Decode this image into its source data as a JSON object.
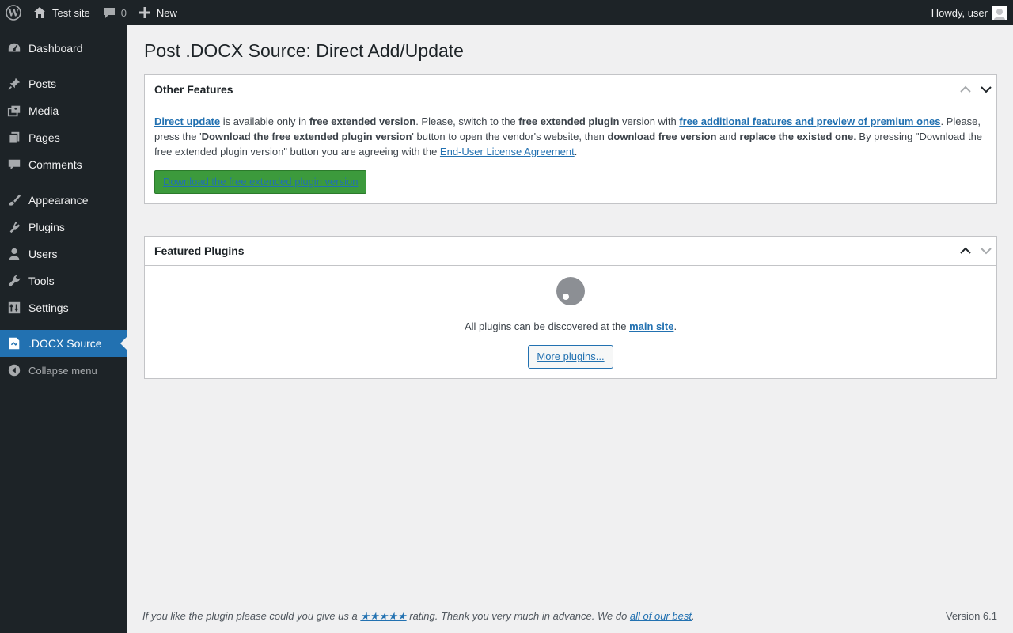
{
  "adminbar": {
    "site_name": "Test site",
    "comments_count": "0",
    "new_label": "New",
    "howdy": "Howdy, user"
  },
  "sidebar": {
    "items": [
      {
        "label": "Dashboard",
        "icon": "dashboard-icon"
      },
      {
        "label": "Posts",
        "icon": "pin-icon"
      },
      {
        "label": "Media",
        "icon": "media-icon"
      },
      {
        "label": "Pages",
        "icon": "pages-icon"
      },
      {
        "label": "Comments",
        "icon": "comment-icon"
      },
      {
        "label": "Appearance",
        "icon": "brush-icon"
      },
      {
        "label": "Plugins",
        "icon": "plugin-icon"
      },
      {
        "label": "Users",
        "icon": "user-icon"
      },
      {
        "label": "Tools",
        "icon": "wrench-icon"
      },
      {
        "label": "Settings",
        "icon": "settings-icon"
      },
      {
        "label": ".DOCX Source",
        "icon": "docx-icon"
      }
    ],
    "collapse_label": "Collapse menu"
  },
  "page": {
    "title": "Post .DOCX Source: Direct Add/Update"
  },
  "other_features": {
    "title": "Other Features",
    "link_direct_update": "Direct update",
    "t1": " is available only in ",
    "b1": "free extended version",
    "t2": ". Please, switch to the ",
    "b2": "free extended plugin",
    "t3": " version with ",
    "link_features": "free additional features and preview of premium ones",
    "t4": ". Please, press the '",
    "b3": "Download the free extended plugin version",
    "t5": "' button to open the vendor's website, then ",
    "b4": "download free version",
    "t6": " and ",
    "b5": "replace the existed one",
    "t7": ". By pressing \"Download the free extended plugin version\" button you are agreeing with the ",
    "link_eula": "End-User License Agreement",
    "t8": ".",
    "button_label": "Download the free extended plugin version"
  },
  "featured_plugins": {
    "title": "Featured Plugins",
    "text_before": "All plugins can be discovered at the ",
    "link_main_site": "main site",
    "text_after": ".",
    "button_label": "More plugins..."
  },
  "footer": {
    "text1": "If you like the plugin please could you give us a ",
    "stars": "★★★★★",
    "text2": " rating. Thank you very much in advance. We do ",
    "link_best": "all of our best",
    "text3": ".",
    "version": "Version 6.1"
  },
  "colors": {
    "admin_bg": "#1d2327",
    "accent": "#2271b1",
    "green_button": "#3c9a3c",
    "page_bg": "#f0f0f1"
  }
}
